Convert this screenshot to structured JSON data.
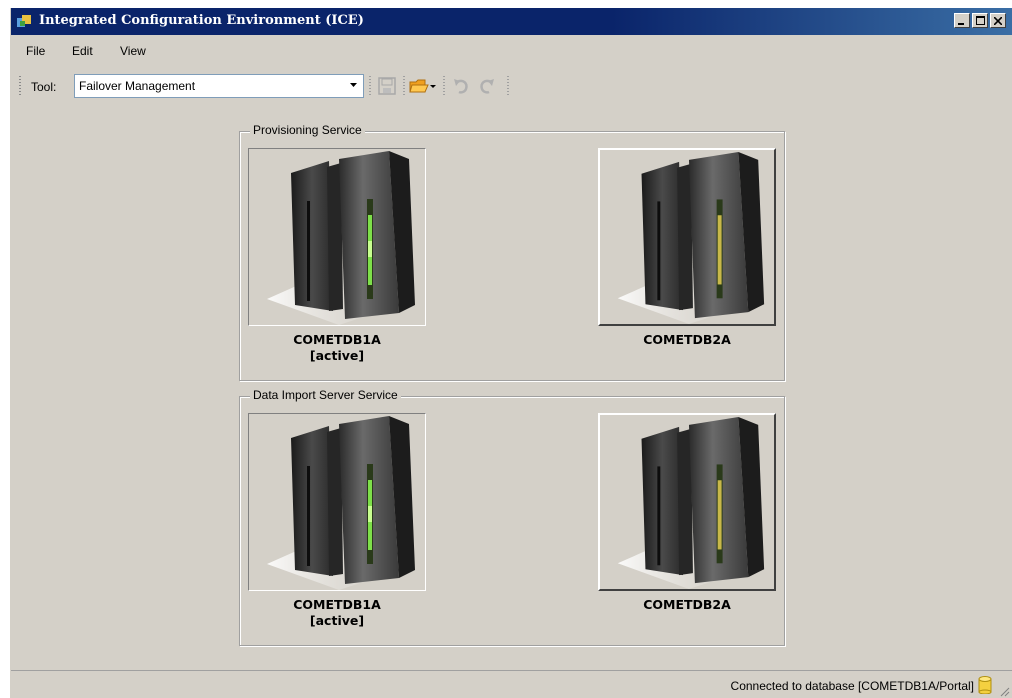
{
  "window": {
    "title": "Integrated Configuration Environment (ICE)"
  },
  "menu": [
    "File",
    "Edit",
    "View"
  ],
  "toolbar": {
    "tool_label": "Tool:",
    "tool_value": "Failover Management",
    "icons": [
      "save-icon",
      "open-folder-icon",
      "undo-icon",
      "redo-icon"
    ]
  },
  "groups": [
    {
      "title": "Provisioning Service",
      "servers": [
        {
          "name": "COMETDB1A",
          "status": "[active]"
        },
        {
          "name": "COMETDB2A",
          "status": ""
        }
      ]
    },
    {
      "title": "Data Import Server Service",
      "servers": [
        {
          "name": "COMETDB1A",
          "status": "[active]"
        },
        {
          "name": "COMETDB2A",
          "status": ""
        }
      ]
    }
  ],
  "status": {
    "text": "Connected to database [COMETDB1A/Portal]"
  },
  "colors": {
    "active_led": "#7ee04a",
    "inactive_led": "#c8b84a",
    "titlebar": "#0a246a"
  }
}
